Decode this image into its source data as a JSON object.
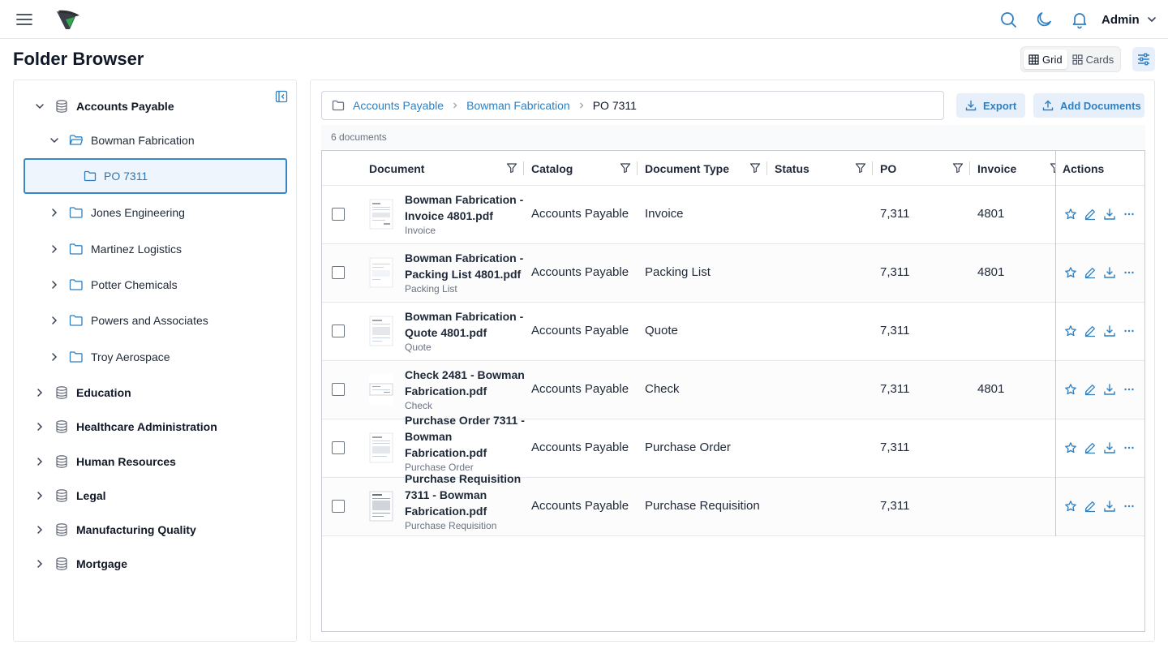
{
  "header": {
    "user_name": "Admin",
    "accent": "#2f7fc1"
  },
  "page": {
    "title": "Folder Browser",
    "view_options": [
      "Grid",
      "Cards"
    ],
    "active_view": "Grid"
  },
  "tree": {
    "root_open": "Accounts Payable",
    "child_open": "Bowman Fabrication",
    "selected": "PO 7311",
    "siblings": [
      "Jones Engineering",
      "Martinez Logistics",
      "Potter Chemicals",
      "Powers and Associates",
      "Troy Aerospace"
    ],
    "catalogs": [
      "Education",
      "Healthcare Administration",
      "Human Resources",
      "Legal",
      "Manufacturing Quality",
      "Mortgage"
    ]
  },
  "breadcrumb": {
    "items": [
      "Accounts Payable",
      "Bowman Fabrication"
    ],
    "current": "PO 7311"
  },
  "toolbar": {
    "export_label": "Export",
    "add_label": "Add Documents"
  },
  "grid": {
    "count_label": "6 documents",
    "columns": [
      "Document",
      "Catalog",
      "Document Type",
      "Status",
      "PO",
      "Invoice",
      "Actions"
    ],
    "rows": [
      {
        "title": [
          "Bowman Fabrication -",
          "Invoice 4801.pdf"
        ],
        "sub": "Invoice",
        "catalog": "Accounts Payable",
        "type": "Invoice",
        "status": "",
        "po": "7,311",
        "invoice": "4801"
      },
      {
        "title": [
          "Bowman Fabrication -",
          "Packing List 4801.pdf"
        ],
        "sub": "Packing List",
        "catalog": "Accounts Payable",
        "type": "Packing List",
        "status": "",
        "po": "7,311",
        "invoice": "4801"
      },
      {
        "title": [
          "Bowman Fabrication -",
          "Quote 4801.pdf"
        ],
        "sub": "Quote",
        "catalog": "Accounts Payable",
        "type": "Quote",
        "status": "",
        "po": "7,311",
        "invoice": ""
      },
      {
        "title": [
          "Check 2481 - Bowman",
          "Fabrication.pdf"
        ],
        "sub": "Check",
        "catalog": "Accounts Payable",
        "type": "Check",
        "status": "",
        "po": "7,311",
        "invoice": "4801"
      },
      {
        "title": [
          "Purchase Order 7311 -",
          "Bowman",
          "Fabrication.pdf"
        ],
        "sub": "Purchase Order",
        "catalog": "Accounts Payable",
        "type": "Purchase Order",
        "status": "",
        "po": "7,311",
        "invoice": ""
      },
      {
        "title": [
          "Purchase Requisition",
          "7311 - Bowman",
          "Fabrication.pdf"
        ],
        "sub": "Purchase Requisition",
        "catalog": "Accounts Payable",
        "type": "Purchase Requisition",
        "status": "",
        "po": "7,311",
        "invoice": ""
      }
    ]
  }
}
